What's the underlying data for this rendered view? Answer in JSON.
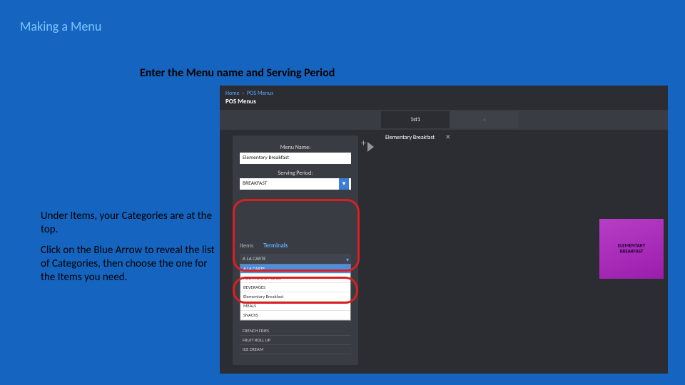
{
  "slide": {
    "title": "Making a Menu",
    "subtitle": "Enter the Menu name and Serving Period",
    "body1": "Under Items, your Categories are at the top.",
    "body2": "Click on the Blue Arrow to reveal the list of Categories, then choose the one for the Items you need."
  },
  "app": {
    "breadcrumb_home": "Home",
    "breadcrumb_current": "POS Menus",
    "page_title": "POS Menus",
    "tab1": "1st1",
    "tab2": "-",
    "tile_label": "Elementary Breakfast",
    "tile_x": "✕",
    "plus": "+"
  },
  "panel": {
    "menu_name_label": "Menu Name:",
    "menu_name_value": "Elementary Breakfast",
    "serving_period_label": "Serving Period:",
    "serving_period_value": "BREAKFAST",
    "tab_items": "Items",
    "tab_terminals": "Terminals",
    "category_selected": "A LA CARTE",
    "categories": [
      "A LA CARTE",
      "ADDITIONAL MEALS",
      "BEVERAGES",
      "Elementary Breakfast",
      "MEALS",
      "SNACKS"
    ],
    "items": [
      "FRENCH FRIES",
      "FRUIT ROLL UP",
      "ICE CREAM"
    ]
  },
  "tile": {
    "line1": "ELEMENTARY",
    "line2": "BREAKFAST"
  }
}
